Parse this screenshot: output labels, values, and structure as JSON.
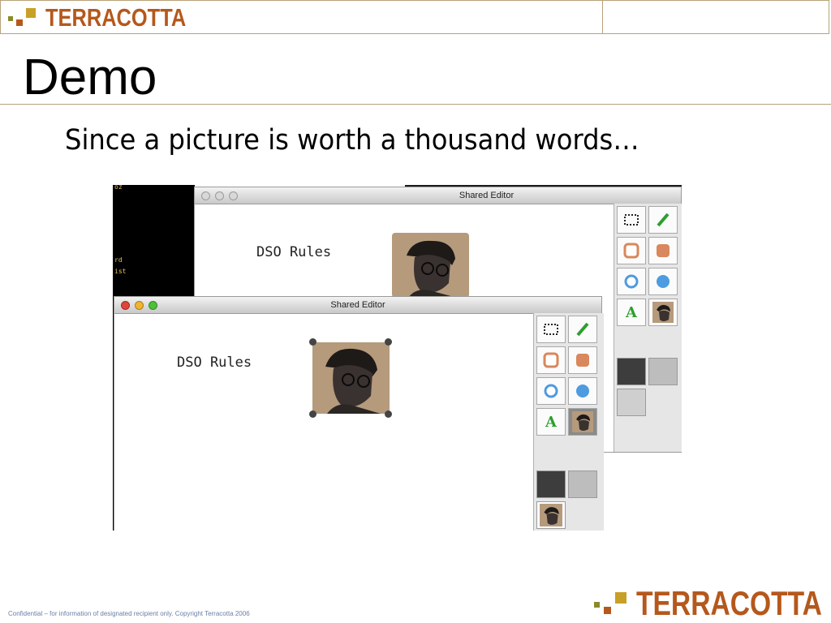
{
  "header": {
    "logo_text": "TERRACOTTA"
  },
  "slide": {
    "title": "Demo",
    "subtitle": "Since a picture is worth a thousand words…"
  },
  "terminal": {
    "lines": [
      "oz",
      "rd",
      "ist"
    ]
  },
  "back_window": {
    "title": "Shared Editor",
    "canvas_text": "DSO Rules"
  },
  "front_window": {
    "title": "Shared Editor",
    "canvas_text": "DSO Rules"
  },
  "palette": {
    "tools": [
      "select-rect-tool",
      "line-tool",
      "rect-outline-tool",
      "rect-filled-tool",
      "oval-outline-tool",
      "oval-filled-tool",
      "text-tool",
      "image-tool"
    ],
    "text_tool_glyph": "A",
    "colors": {
      "dark": "#3d3d3d",
      "light": "#bdbdbd",
      "orange": "#d9875c",
      "blue": "#4d9be0",
      "green": "#2e9e2e"
    }
  },
  "footer": {
    "confidential": "Confidential – for information of designated recipient only.  Copyright Terracotta 2006",
    "logo_text": "TERRACOTTA"
  },
  "colors": {
    "brand": "#b5581c",
    "accent_olive": "#8a8a2a",
    "rule": "#b8a27a"
  }
}
